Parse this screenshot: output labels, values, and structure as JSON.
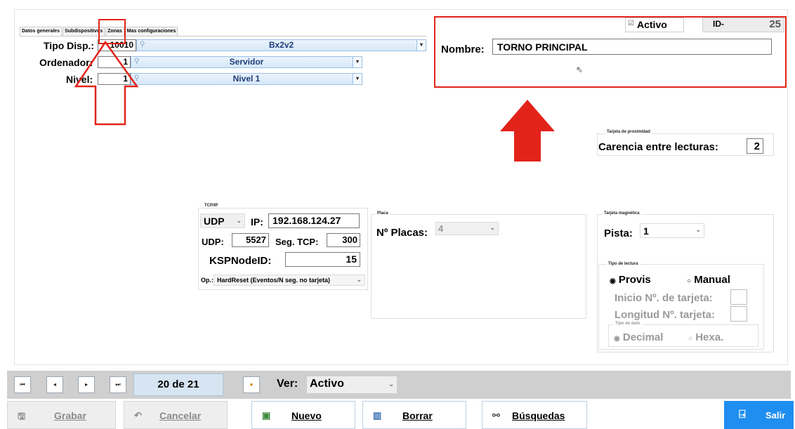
{
  "tabs": [
    "Datos generales",
    "Subdispositivos",
    "Zonas",
    "Mas configuraciones"
  ],
  "general": {
    "tipo_disp_label": "Tipo Disp.:",
    "tipo_disp_code": "10010",
    "tipo_disp_value": "Bx2v2",
    "ordenador_label": "Ordenador:",
    "ordenador_code": "1",
    "ordenador_value": "Servidor",
    "nivel_label": "Nivel:",
    "nivel_code": "1",
    "nivel_value": "Nivel 1"
  },
  "header": {
    "activo_label": "Activo",
    "activo_checked": true,
    "id_label": "ID-",
    "id_value": "25",
    "nombre_label": "Nombre:",
    "nombre_value": "TORNO PRINCIPAL"
  },
  "proximidad": {
    "title": "Tarjeta de proximidad",
    "carencia_label": "Carencia entre lecturas:",
    "carencia_value": "2"
  },
  "tcpip": {
    "title": "TCP/IP",
    "protocol": "UDP",
    "ip_label": "IP:",
    "ip_value": "192.168.124.27",
    "udp_label": "UDP:",
    "udp_value": "5527",
    "segtcp_label": "Seg. TCP:",
    "segtcp_value": "300",
    "ksp_label": "KSPNodeID:",
    "ksp_value": "15",
    "op_label": "Op.:",
    "op_value": "HardReset (Eventos/N seg. no tarjeta)"
  },
  "placa": {
    "title": "Placa",
    "nplacas_label": "Nº Placas:",
    "nplacas_value": "4"
  },
  "magnetica": {
    "title": "Tarjeta magnética",
    "pista_label": "Pista:",
    "pista_value": "1",
    "lectura_title": "Tipo de lectura",
    "provis_label": "Provis",
    "manual_label": "Manual",
    "inicio_label": "Inicio Nº. de tarjeta:",
    "longitud_label": "Longitud Nº. tarjeta:",
    "tipodato_title": "Tipo de dato",
    "decimal_label": "Decimal",
    "hexa_label": "Hexa."
  },
  "nav": {
    "record_position": "20 de 21",
    "ver_label": "Ver:",
    "ver_value": "Activo"
  },
  "buttons": {
    "grabar": "Grabar",
    "cancelar": "Cancelar",
    "nuevo": "Nuevo",
    "borrar": "Borrar",
    "busquedas": "Búsquedas",
    "salir": "Salir"
  },
  "colors": {
    "annotation_red": "#e2231a",
    "salir_blue": "#1e8ef0",
    "combo_text": "#1f3c7a"
  }
}
